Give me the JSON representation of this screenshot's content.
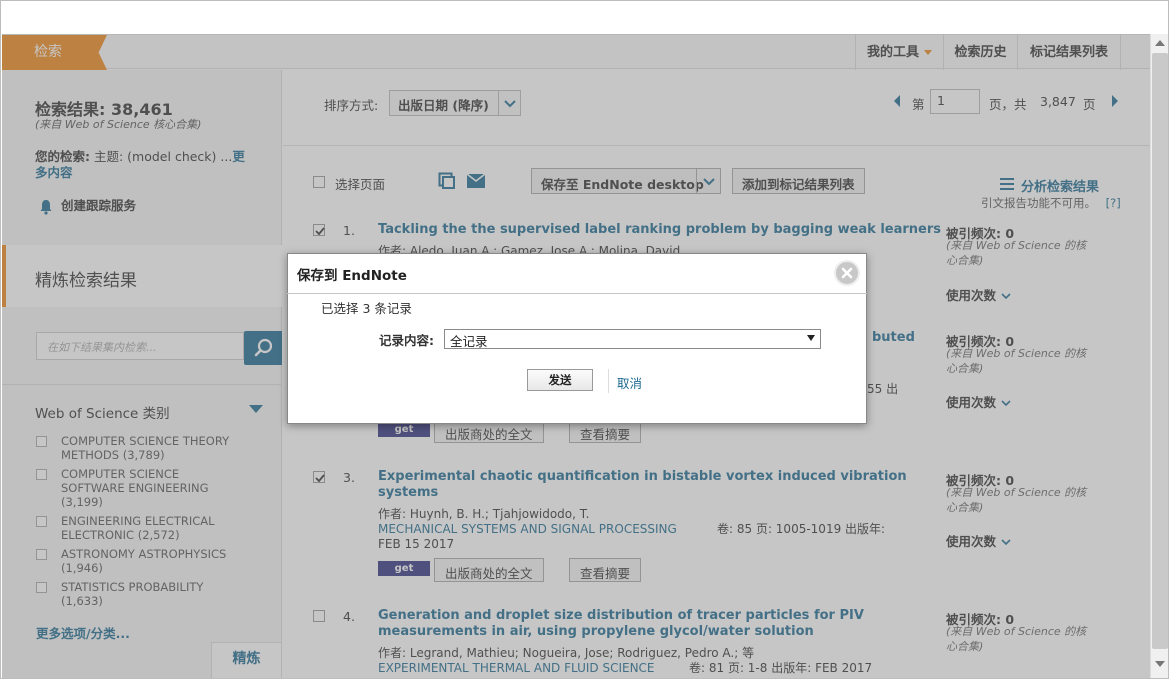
{
  "header": {
    "search_tab": "检索",
    "my_tools": "我的工具",
    "search_history": "检索历史",
    "marked_list": "标记结果列表"
  },
  "sidebar": {
    "results_label": "检索结果:",
    "results_count": "38,461",
    "results_source": "(来自 Web of Science 核心合集)",
    "your_search_label": "您的检索:",
    "your_search_value": "主题: (model check) ...",
    "more_content": "更多内容",
    "create_alert": "创建跟踪服务",
    "refine_title": "精炼检索结果",
    "refine_placeholder": "在如下结果集内检索...",
    "category_title": "Web of Science 类别",
    "categories": [
      {
        "line1": "COMPUTER SCIENCE THEORY",
        "line2": "METHODS (3,789)",
        "line3": ""
      },
      {
        "line1": "COMPUTER SCIENCE",
        "line2": "SOFTWARE ENGINEERING",
        "line3": "(3,199)"
      },
      {
        "line1": "ENGINEERING ELECTRICAL",
        "line2": "ELECTRONIC (2,572)",
        "line3": ""
      },
      {
        "line1": "ASTRONOMY ASTROPHYSICS",
        "line2": "(1,946)",
        "line3": ""
      },
      {
        "line1": "STATISTICS PROBABILITY",
        "line2": "(1,633)",
        "line3": ""
      }
    ],
    "more_options": "更多选项/分类...",
    "refine_button": "精炼"
  },
  "toolbar": {
    "sort_label": "排序方式:",
    "sort_value": "出版日期 (降序)",
    "page_prefix": "第",
    "page_value": "1",
    "page_mid": "页，共",
    "page_total": "3,847",
    "page_suffix": "页",
    "select_page": "选择页面",
    "save_endnote": "保存至 EndNote desktop",
    "add_marked": "添加到标记结果列表",
    "analyze": "分析检索结果",
    "analyze_note": "引文报告功能不可用。",
    "help": "[?]"
  },
  "records": [
    {
      "num": "1.",
      "title_l1": "Tackling the the supervised label ranking problem by bagging weak learners",
      "title_l2": "",
      "authors": "作者: Aledo, Juan A.; Gamez, Jose A.; Molina, David",
      "journal": "",
      "cite_label": "被引频次: 0",
      "cite_src_l1": "(来自 Web of Science 的核",
      "cite_src_l2": "心合集)",
      "usage": "使用次数",
      "checked": true
    },
    {
      "num": "2.",
      "title_tail": "buted",
      "fragment": "55   出",
      "fulltext_btn": "出版商处的全文",
      "abstract_btn": "查看摘要",
      "cite_label": "被引频次: 0",
      "cite_src_l1": "(来自 Web of Science 的核",
      "cite_src_l2": "心合集)",
      "usage": "使用次数"
    },
    {
      "num": "3.",
      "title_l1": "Experimental chaotic quantification in bistable vortex induced vibration",
      "title_l2": "systems",
      "authors": "作者: Huynh, B. H.; Tjahjowidodo, T.",
      "journal": "MECHANICAL SYSTEMS AND SIGNAL PROCESSING",
      "vol": "卷: 85   页: 1005-1019   出版年:",
      "date": "FEB 15 2017",
      "fulltext_btn": "出版商处的全文",
      "abstract_btn": "查看摘要",
      "cite_label": "被引频次: 0",
      "cite_src_l1": "(来自 Web of Science 的核",
      "cite_src_l2": "心合集)",
      "usage": "使用次数",
      "checked": true
    },
    {
      "num": "4.",
      "title_l1": "Generation and droplet size distribution of tracer particles for PIV",
      "title_l2": "measurements in air, using propylene glycol/water solution",
      "authors": "作者: Legrand, Mathieu; Nogueira, Jose; Rodriguez, Pedro A.; 等",
      "journal": "EXPERIMENTAL THERMAL AND FLUID SCIENCE",
      "vol": "卷: 81   页: 1-8   出版年: FEB 2017",
      "cite_label": "被引频次: 0",
      "cite_src_l1": "(来自 Web of Science 的核",
      "cite_src_l2": "心合集)",
      "checked": false
    }
  ],
  "getit_label": "get it@BIT",
  "dialog": {
    "title": "保存到 EndNote",
    "selected": "已选择 3 条记录",
    "content_label": "记录内容:",
    "content_value": "全记录",
    "send": "发送",
    "cancel": "取消"
  },
  "colors": {
    "accent_orange": "#f08a1c",
    "link_blue": "#1e6b92",
    "getit_bg": "#353586"
  }
}
